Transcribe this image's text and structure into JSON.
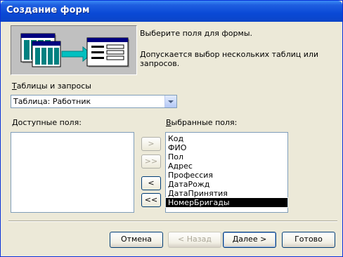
{
  "window": {
    "title": "Создание форм"
  },
  "instructions": {
    "line1": "Выберите поля для формы.",
    "line2": "Допускается выбор нескольких таблиц или запросов."
  },
  "tables": {
    "label_accel": "Т",
    "label_rest": "аблицы и запросы",
    "selected": "Таблица: Работник"
  },
  "available": {
    "label_accel": "Д",
    "label_rest": "оступные поля:",
    "items": []
  },
  "selected_fields": {
    "label_accel": "В",
    "label_rest": "ыбранные поля:",
    "items": [
      "Код",
      "ФИО",
      "Пол",
      "Адрес",
      "Профессия",
      "ДатаРожд",
      "ДатаПринятия",
      "НомерБригады"
    ],
    "highlighted": "НомерБригады"
  },
  "move_buttons": {
    "add": ">",
    "add_all": ">>",
    "remove": "<",
    "remove_all": "<<"
  },
  "footer": {
    "cancel": "Отмена",
    "back": "< Назад",
    "next": "Далее >",
    "finish": "Готово"
  }
}
